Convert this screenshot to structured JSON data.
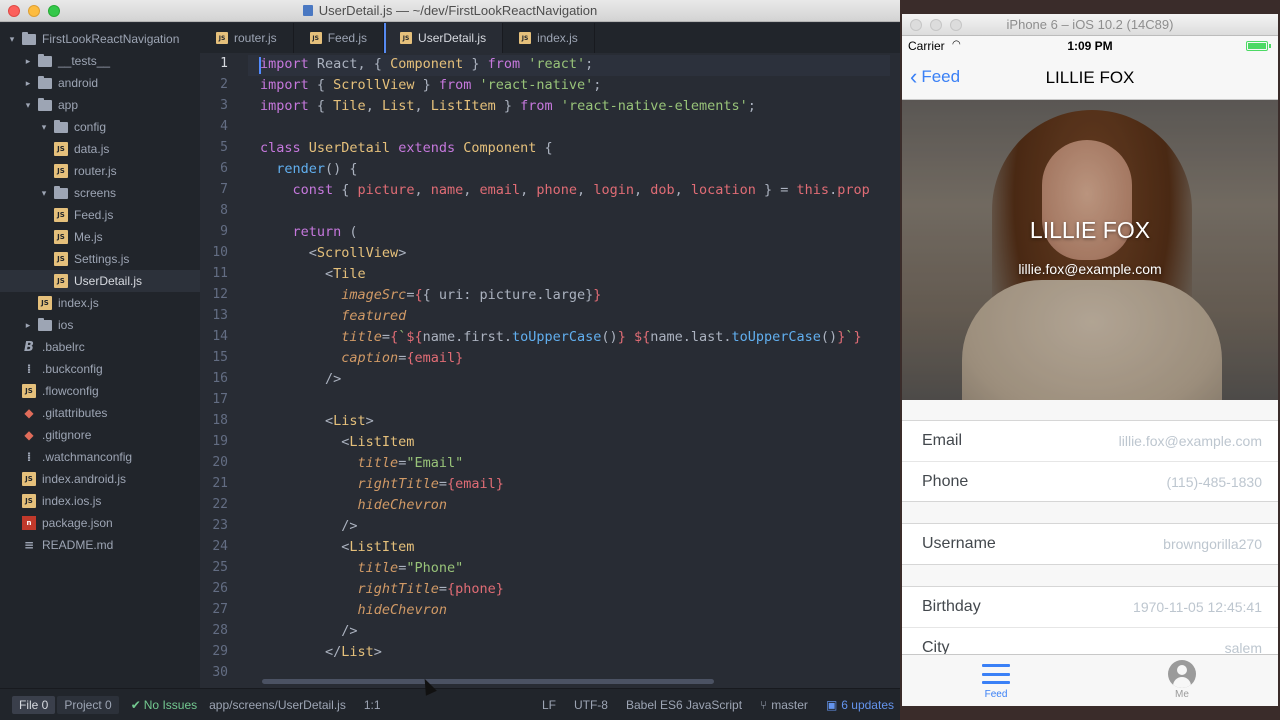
{
  "editor": {
    "window_title": "UserDetail.js — ~/dev/FirstLookReactNavigation",
    "tree": [
      {
        "label": "FirstLookReactNavigation",
        "type": "root",
        "depth": 0,
        "expanded": true
      },
      {
        "label": "__tests__",
        "type": "folder",
        "depth": 1,
        "expanded": false
      },
      {
        "label": "android",
        "type": "folder",
        "depth": 1,
        "expanded": false
      },
      {
        "label": "app",
        "type": "folder",
        "depth": 1,
        "expanded": true
      },
      {
        "label": "config",
        "type": "folder",
        "depth": 2,
        "expanded": true
      },
      {
        "label": "data.js",
        "type": "js",
        "depth": 3
      },
      {
        "label": "router.js",
        "type": "js",
        "depth": 3
      },
      {
        "label": "screens",
        "type": "folder",
        "depth": 2,
        "expanded": true
      },
      {
        "label": "Feed.js",
        "type": "js",
        "depth": 3
      },
      {
        "label": "Me.js",
        "type": "js",
        "depth": 3
      },
      {
        "label": "Settings.js",
        "type": "js",
        "depth": 3
      },
      {
        "label": "UserDetail.js",
        "type": "js",
        "depth": 3,
        "selected": true
      },
      {
        "label": "index.js",
        "type": "js",
        "depth": 2
      },
      {
        "label": "ios",
        "type": "folder",
        "depth": 1,
        "expanded": false
      },
      {
        "label": ".babelrc",
        "type": "babel",
        "depth": 1
      },
      {
        "label": ".buckconfig",
        "type": "cfg",
        "depth": 1
      },
      {
        "label": ".flowconfig",
        "type": "js",
        "depth": 1
      },
      {
        "label": ".gitattributes",
        "type": "git",
        "depth": 1
      },
      {
        "label": ".gitignore",
        "type": "git",
        "depth": 1
      },
      {
        "label": ".watchmanconfig",
        "type": "cfg",
        "depth": 1
      },
      {
        "label": "index.android.js",
        "type": "js",
        "depth": 1
      },
      {
        "label": "index.ios.js",
        "type": "js",
        "depth": 1
      },
      {
        "label": "package.json",
        "type": "npm",
        "depth": 1
      },
      {
        "label": "README.md",
        "type": "md",
        "depth": 1
      }
    ],
    "tabs": [
      {
        "label": "router.js",
        "active": false
      },
      {
        "label": "Feed.js",
        "active": false
      },
      {
        "label": "UserDetail.js",
        "active": true
      },
      {
        "label": "index.js",
        "active": false
      }
    ],
    "code_lines": [
      [
        [
          "k",
          "import"
        ],
        [
          "p",
          " React, { "
        ],
        [
          "c",
          "Component"
        ],
        [
          "p",
          " } "
        ],
        [
          "k",
          "from"
        ],
        [
          "p",
          " "
        ],
        [
          "s",
          "'react'"
        ],
        [
          "p",
          ";"
        ]
      ],
      [
        [
          "k",
          "import"
        ],
        [
          "p",
          " { "
        ],
        [
          "c",
          "ScrollView"
        ],
        [
          "p",
          " } "
        ],
        [
          "k",
          "from"
        ],
        [
          "p",
          " "
        ],
        [
          "s",
          "'react-native'"
        ],
        [
          "p",
          ";"
        ]
      ],
      [
        [
          "k",
          "import"
        ],
        [
          "p",
          " { "
        ],
        [
          "c",
          "Tile"
        ],
        [
          "p",
          ", "
        ],
        [
          "c",
          "List"
        ],
        [
          "p",
          ", "
        ],
        [
          "c",
          "ListItem"
        ],
        [
          "p",
          " } "
        ],
        [
          "k",
          "from"
        ],
        [
          "p",
          " "
        ],
        [
          "s",
          "'react-native-elements'"
        ],
        [
          "p",
          ";"
        ]
      ],
      [],
      [
        [
          "k",
          "class"
        ],
        [
          "p",
          " "
        ],
        [
          "c",
          "UserDetail"
        ],
        [
          "p",
          " "
        ],
        [
          "k",
          "extends"
        ],
        [
          "p",
          " "
        ],
        [
          "c",
          "Component"
        ],
        [
          "p",
          " {"
        ]
      ],
      [
        [
          "p",
          "  "
        ],
        [
          "f",
          "render"
        ],
        [
          "p",
          "() {"
        ]
      ],
      [
        [
          "p",
          "    "
        ],
        [
          "k",
          "const"
        ],
        [
          "p",
          " { "
        ],
        [
          "v",
          "picture"
        ],
        [
          "p",
          ", "
        ],
        [
          "v",
          "name"
        ],
        [
          "p",
          ", "
        ],
        [
          "v",
          "email"
        ],
        [
          "p",
          ", "
        ],
        [
          "v",
          "phone"
        ],
        [
          "p",
          ", "
        ],
        [
          "v",
          "login"
        ],
        [
          "p",
          ", "
        ],
        [
          "v",
          "dob"
        ],
        [
          "p",
          ", "
        ],
        [
          "v",
          "location"
        ],
        [
          "p",
          " } = "
        ],
        [
          "v",
          "this"
        ],
        [
          "p",
          "."
        ],
        [
          "v",
          "prop"
        ]
      ],
      [],
      [
        [
          "p",
          "    "
        ],
        [
          "k",
          "return"
        ],
        [
          "p",
          " ("
        ]
      ],
      [
        [
          "p",
          "      <"
        ],
        [
          "c",
          "ScrollView"
        ],
        [
          "p",
          ">"
        ]
      ],
      [
        [
          "p",
          "        <"
        ],
        [
          "c",
          "Tile"
        ]
      ],
      [
        [
          "p",
          "          "
        ],
        [
          "a",
          "imageSrc"
        ],
        [
          "p",
          "="
        ],
        [
          "v",
          "{"
        ],
        [
          "p",
          "{ uri: picture.large}"
        ],
        [
          "v",
          "}"
        ]
      ],
      [
        [
          "p",
          "          "
        ],
        [
          "a",
          "featured"
        ]
      ],
      [
        [
          "p",
          "          "
        ],
        [
          "a",
          "title"
        ],
        [
          "p",
          "="
        ],
        [
          "v",
          "{"
        ],
        [
          "s",
          "`"
        ],
        [
          "v",
          "${"
        ],
        [
          "p",
          "name.first."
        ],
        [
          "f",
          "toUpperCase"
        ],
        [
          "p",
          "()"
        ],
        [
          "v",
          "}"
        ],
        [
          "s",
          " "
        ],
        [
          "v",
          "${"
        ],
        [
          "p",
          "name.last."
        ],
        [
          "f",
          "toUpperCase"
        ],
        [
          "p",
          "()"
        ],
        [
          "v",
          "}"
        ],
        [
          "s",
          "`"
        ],
        [
          "v",
          "}"
        ]
      ],
      [
        [
          "p",
          "          "
        ],
        [
          "a",
          "caption"
        ],
        [
          "p",
          "="
        ],
        [
          "v",
          "{email}"
        ]
      ],
      [
        [
          "p",
          "        />"
        ]
      ],
      [],
      [
        [
          "p",
          "        <"
        ],
        [
          "c",
          "List"
        ],
        [
          "p",
          ">"
        ]
      ],
      [
        [
          "p",
          "          <"
        ],
        [
          "c",
          "ListItem"
        ]
      ],
      [
        [
          "p",
          "            "
        ],
        [
          "a",
          "title"
        ],
        [
          "p",
          "="
        ],
        [
          "s",
          "\"Email\""
        ]
      ],
      [
        [
          "p",
          "            "
        ],
        [
          "a",
          "rightTitle"
        ],
        [
          "p",
          "="
        ],
        [
          "v",
          "{email}"
        ]
      ],
      [
        [
          "p",
          "            "
        ],
        [
          "a",
          "hideChevron"
        ]
      ],
      [
        [
          "p",
          "          />"
        ]
      ],
      [
        [
          "p",
          "          <"
        ],
        [
          "c",
          "ListItem"
        ]
      ],
      [
        [
          "p",
          "            "
        ],
        [
          "a",
          "title"
        ],
        [
          "p",
          "="
        ],
        [
          "s",
          "\"Phone\""
        ]
      ],
      [
        [
          "p",
          "            "
        ],
        [
          "a",
          "rightTitle"
        ],
        [
          "p",
          "="
        ],
        [
          "v",
          "{phone}"
        ]
      ],
      [
        [
          "p",
          "            "
        ],
        [
          "a",
          "hideChevron"
        ]
      ],
      [
        [
          "p",
          "          />"
        ]
      ],
      [
        [
          "p",
          "        </"
        ],
        [
          "c",
          "List"
        ],
        [
          "p",
          ">"
        ]
      ],
      []
    ],
    "current_line": 1,
    "status": {
      "file_label": "File 0",
      "project_label": "Project 0",
      "issues": "No Issues",
      "path": "app/screens/UserDetail.js",
      "cursor_pos": "1:1",
      "line_ending": "LF",
      "encoding": "UTF-8",
      "grammar": "Babel ES6 JavaScript",
      "branch": "master",
      "updates": "6 updates"
    }
  },
  "simulator": {
    "window_title": "iPhone 6 – iOS 10.2 (14C89)",
    "carrier": "Carrier",
    "time": "1:09 PM",
    "back_label": "Feed",
    "nav_title": "LILLIE FOX",
    "hero_name": "LILLIE FOX",
    "hero_email": "lillie.fox@example.com",
    "groups": [
      [
        {
          "title": "Email",
          "value": "lillie.fox@example.com"
        },
        {
          "title": "Phone",
          "value": "(115)-485-1830"
        }
      ],
      [
        {
          "title": "Username",
          "value": "browngorilla270"
        }
      ],
      [
        {
          "title": "Birthday",
          "value": "1970-11-05 12:45:41"
        },
        {
          "title": "City",
          "value": "salem"
        }
      ]
    ],
    "tabs": {
      "feed": "Feed",
      "me": "Me"
    }
  },
  "colors": {
    "editor_bg": "#282c34",
    "sidebar_bg": "#21252b",
    "accent_blue": "#568af2",
    "ios_tint": "#3a80f6"
  }
}
